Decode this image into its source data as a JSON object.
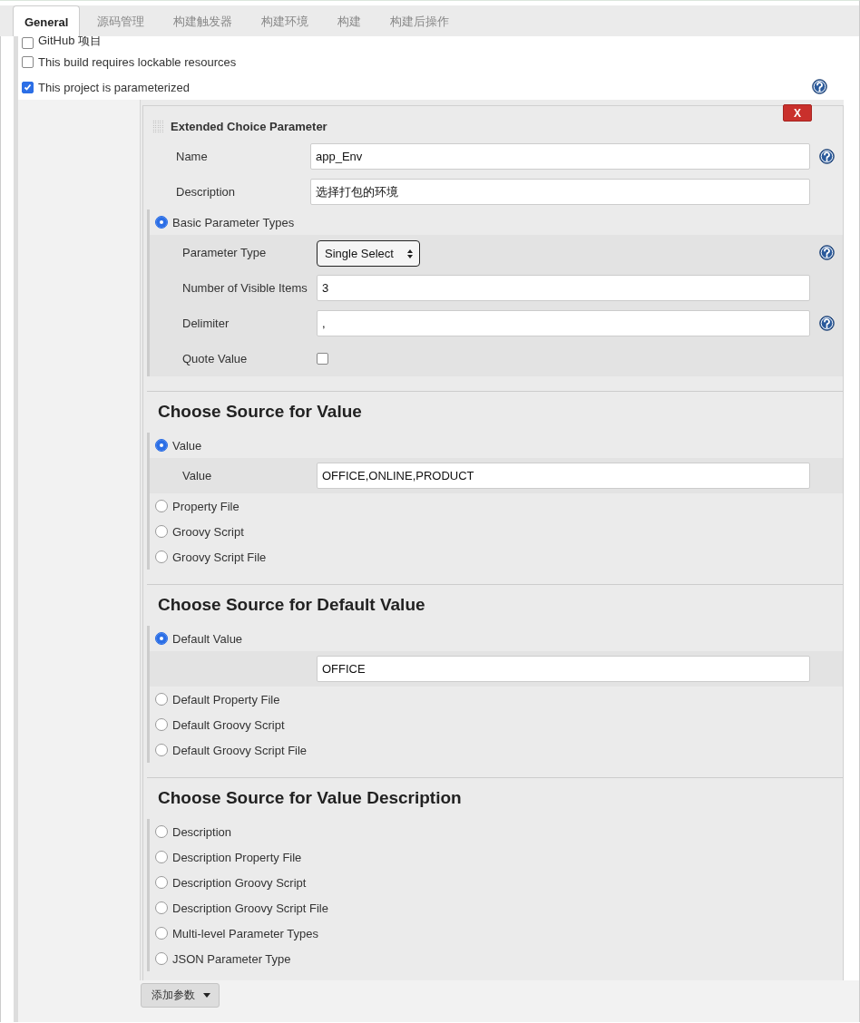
{
  "tabs": [
    {
      "label": "General",
      "selected": true
    },
    {
      "label": "源码管理",
      "selected": false
    },
    {
      "label": "构建触发器",
      "selected": false
    },
    {
      "label": "构建环境",
      "selected": false
    },
    {
      "label": "构建",
      "selected": false
    },
    {
      "label": "构建后操作",
      "selected": false
    }
  ],
  "options": [
    {
      "label": "GitHub 项目",
      "checked": false,
      "help": false
    },
    {
      "label": "This build requires lockable resources",
      "checked": false,
      "help": false
    },
    {
      "label": "This project is parameterized",
      "checked": true,
      "help": true
    }
  ],
  "parameter": {
    "title": "Extended Choice Parameter",
    "delete_label": "X",
    "fields": [
      {
        "kind": "text",
        "label": "Name",
        "value": "app_Env",
        "help": true
      },
      {
        "kind": "text",
        "label": "Description",
        "value": "选择打包的环境",
        "help": false
      }
    ],
    "type_option": {
      "label": "Basic Parameter Types",
      "selected": true,
      "fields": [
        {
          "kind": "select",
          "label": "Parameter Type",
          "value": "Single Select",
          "help": true
        },
        {
          "kind": "text",
          "label": "Number of Visible Items",
          "value": "3",
          "help": false
        },
        {
          "kind": "text",
          "label": "Delimiter",
          "value": ",",
          "help": true
        },
        {
          "kind": "checkbox",
          "label": "Quote Value",
          "checked": false,
          "help": false
        }
      ]
    },
    "sections": [
      {
        "heading": "Choose Source for Value",
        "options": [
          {
            "label": "Value",
            "selected": true,
            "fields": [
              {
                "kind": "text",
                "label": "Value",
                "value": "OFFICE,ONLINE,PRODUCT",
                "help": false
              }
            ]
          },
          {
            "label": "Property File",
            "selected": false
          },
          {
            "label": "Groovy Script",
            "selected": false
          },
          {
            "label": "Groovy Script File",
            "selected": false
          }
        ]
      },
      {
        "heading": "Choose Source for Default Value",
        "options": [
          {
            "label": "Default Value",
            "selected": true,
            "fields": [
              {
                "kind": "text",
                "value": "OFFICE",
                "help": false
              }
            ]
          },
          {
            "label": "Default Property File",
            "selected": false
          },
          {
            "label": "Default Groovy Script",
            "selected": false
          },
          {
            "label": "Default Groovy Script File",
            "selected": false
          }
        ]
      },
      {
        "heading": "Choose Source for Value Description",
        "options": [
          {
            "label": "Description",
            "selected": false
          },
          {
            "label": "Description Property File",
            "selected": false
          },
          {
            "label": "Description Groovy Script",
            "selected": false
          },
          {
            "label": "Description Groovy Script File",
            "selected": false
          },
          {
            "label": "Multi-level Parameter Types",
            "selected": false
          },
          {
            "label": "JSON Parameter Type",
            "selected": false
          }
        ]
      }
    ]
  },
  "add_button": {
    "label": "添加参数"
  }
}
